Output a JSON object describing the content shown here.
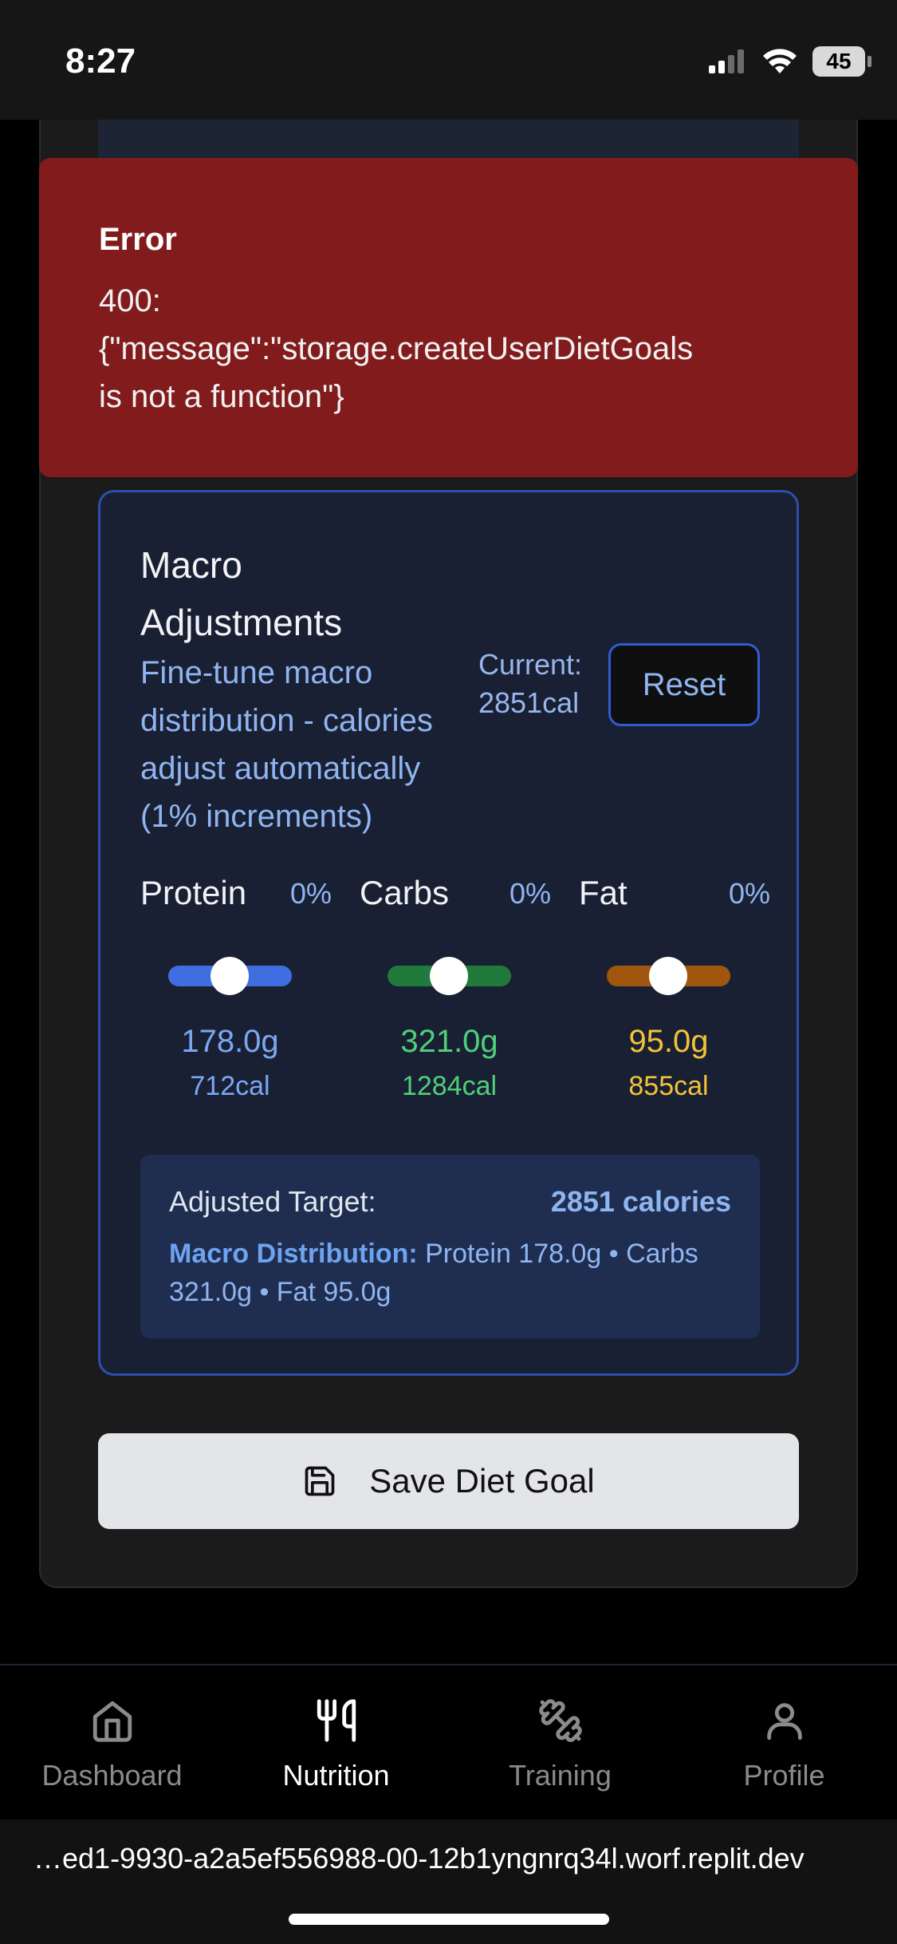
{
  "status_bar": {
    "time": "8:27",
    "battery": "45"
  },
  "error": {
    "title": "Error",
    "message": "400:\n{\"message\":\"storage.createUserDietGoals\nis not a function\"}"
  },
  "macro_card": {
    "title": "Macro Adjustments",
    "description": "Fine-tune macro distribution - calories adjust automatically (1% increments)",
    "current_label": "Current:",
    "current_value": "2851cal",
    "reset_label": "Reset",
    "macros": [
      {
        "name": "Protein",
        "percent": "0%",
        "grams": "178.0g",
        "calories": "712cal",
        "color": "#3f6ee0",
        "text_color": "#7ba7f2"
      },
      {
        "name": "Carbs",
        "percent": "0%",
        "grams": "321.0g",
        "calories": "1284cal",
        "color": "#1f7a3c",
        "text_color": "#4ed07a"
      },
      {
        "name": "Fat",
        "percent": "0%",
        "grams": "95.0g",
        "calories": "855cal",
        "color": "#a0560f",
        "text_color": "#f2c23a"
      }
    ],
    "summary": {
      "target_label": "Adjusted Target:",
      "target_value": "2851 calories",
      "distribution_label": "Macro Distribution:",
      "distribution_text": "Protein 178.0g • Carbs 321.0g • Fat 95.0g"
    }
  },
  "save_button": {
    "label": "Save Diet Goal",
    "icon": "save-icon"
  },
  "bottom_nav": [
    {
      "label": "Dashboard",
      "icon": "home-icon",
      "active": false
    },
    {
      "label": "Nutrition",
      "icon": "utensils-icon",
      "active": true
    },
    {
      "label": "Training",
      "icon": "dumbbell-icon",
      "active": false
    },
    {
      "label": "Profile",
      "icon": "user-icon",
      "active": false
    }
  ],
  "url": "…ed1-9930-a2a5ef556988-00-12b1yngnrq34l.worf.replit.dev"
}
